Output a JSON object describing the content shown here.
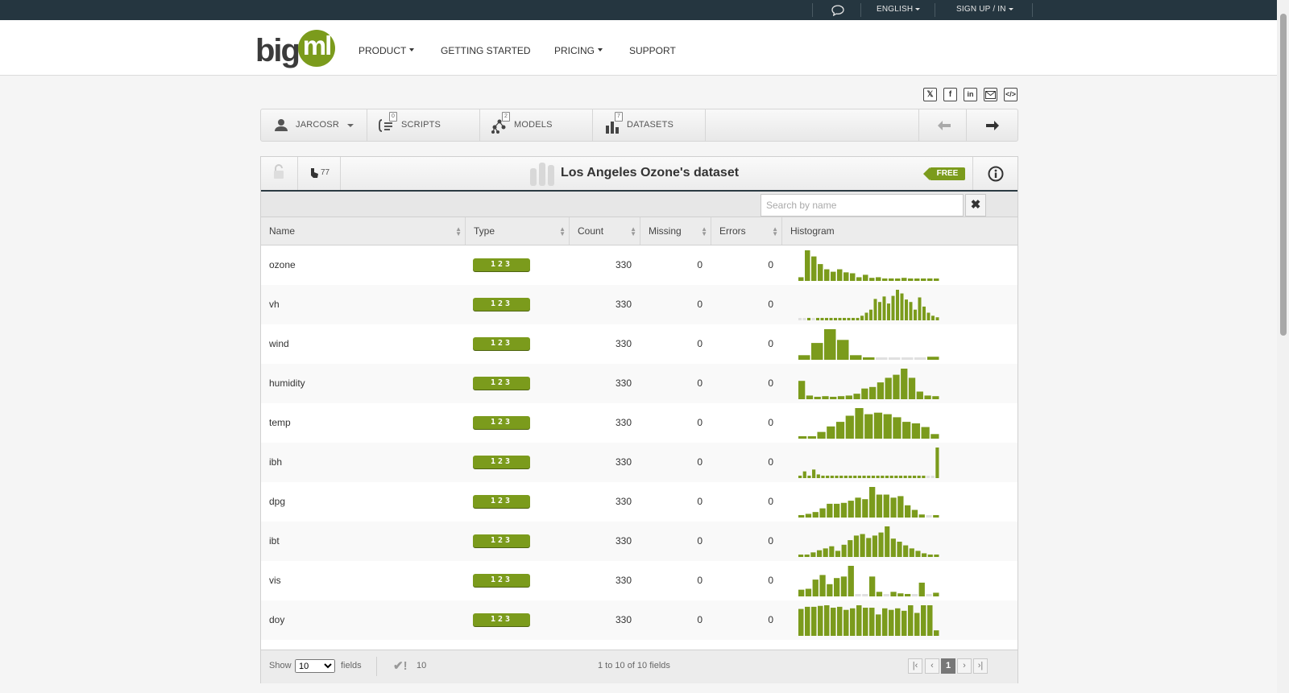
{
  "topbar": {
    "language": "ENGLISH",
    "signup": "SIGN UP / IN"
  },
  "logo": {
    "part1": "big",
    "part2": "ml"
  },
  "nav": [
    {
      "label": "PRODUCT",
      "dropdown": true
    },
    {
      "label": "GETTING STARTED",
      "dropdown": false
    },
    {
      "label": "PRICING",
      "dropdown": true
    },
    {
      "label": "SUPPORT",
      "dropdown": false
    }
  ],
  "share_icons": [
    "x-icon",
    "facebook-icon",
    "linkedin-icon",
    "mail-icon",
    "embed-code-icon"
  ],
  "toolbar": {
    "user": "JARCOSR",
    "scripts": "SCRIPTS",
    "scripts_count": "0",
    "models": "MODELS",
    "models_count": "2",
    "datasets": "DATASETS",
    "datasets_count": "7"
  },
  "dataset": {
    "title": "Los Angeles Ozone's dataset",
    "views": "77",
    "plan_badge": "FREE"
  },
  "search": {
    "placeholder": "Search by name"
  },
  "columns": [
    "Name",
    "Type",
    "Count",
    "Missing",
    "Errors",
    "Histogram"
  ],
  "colors": {
    "accent": "#7b9b1c",
    "topbar": "#253640",
    "empty_bin": "#e0e0e0"
  },
  "fields": [
    {
      "name": "ozone",
      "type": "123",
      "count": "330",
      "missing": "0",
      "errors": "0",
      "histogram": [
        12,
        100,
        80,
        55,
        38,
        30,
        38,
        28,
        25,
        12,
        20,
        10,
        12,
        8,
        8,
        5,
        10,
        5,
        5,
        5,
        8,
        5
      ]
    },
    {
      "name": "vh",
      "type": "123",
      "count": "330",
      "missing": "0",
      "errors": "0",
      "histogram": [
        -1,
        -1,
        8,
        -1,
        8,
        8,
        8,
        8,
        8,
        8,
        8,
        8,
        8,
        8,
        15,
        25,
        35,
        70,
        60,
        78,
        55,
        80,
        100,
        88,
        68,
        60,
        35,
        75,
        45,
        25,
        15,
        10
      ]
    },
    {
      "name": "wind",
      "type": "123",
      "count": "330",
      "missing": "0",
      "errors": "0",
      "histogram": [
        15,
        55,
        100,
        65,
        15,
        8,
        -1,
        -1,
        -1,
        -1,
        10
      ]
    },
    {
      "name": "humidity",
      "type": "123",
      "count": "330",
      "missing": "0",
      "errors": "0",
      "histogram": [
        60,
        12,
        8,
        10,
        8,
        10,
        12,
        18,
        35,
        40,
        55,
        70,
        80,
        100,
        70,
        25,
        12,
        10
      ]
    },
    {
      "name": "temp",
      "type": "123",
      "count": "330",
      "missing": "0",
      "errors": "0",
      "histogram": [
        8,
        8,
        22,
        40,
        55,
        75,
        100,
        80,
        85,
        80,
        70,
        55,
        50,
        38,
        15
      ]
    },
    {
      "name": "ibh",
      "type": "123",
      "count": "330",
      "missing": "0",
      "errors": "0",
      "histogram": [
        8,
        22,
        8,
        28,
        12,
        8,
        8,
        8,
        8,
        8,
        8,
        8,
        8,
        8,
        8,
        8,
        8,
        8,
        8,
        8,
        8,
        8,
        8,
        8,
        8,
        8,
        8,
        8,
        -1,
        -1,
        100
      ]
    },
    {
      "name": "dpg",
      "type": "123",
      "count": "330",
      "missing": "0",
      "errors": "0",
      "histogram": [
        8,
        12,
        18,
        30,
        45,
        45,
        48,
        55,
        65,
        60,
        100,
        75,
        75,
        65,
        70,
        40,
        25,
        10,
        -1,
        8
      ]
    },
    {
      "name": "ibt",
      "type": "123",
      "count": "330",
      "missing": "0",
      "errors": "0",
      "histogram": [
        5,
        8,
        15,
        22,
        28,
        35,
        20,
        40,
        55,
        70,
        75,
        62,
        70,
        80,
        100,
        60,
        50,
        38,
        28,
        20,
        12,
        8,
        8
      ]
    },
    {
      "name": "vis",
      "type": "123",
      "count": "330",
      "missing": "0",
      "errors": "0",
      "histogram": [
        22,
        25,
        55,
        70,
        40,
        60,
        65,
        100,
        -1,
        -1,
        65,
        15,
        -1,
        15,
        10,
        8,
        -1,
        45,
        -1,
        12
      ]
    },
    {
      "name": "doy",
      "type": "123",
      "count": "330",
      "missing": "0",
      "errors": "0",
      "histogram": [
        88,
        95,
        95,
        98,
        100,
        92,
        95,
        85,
        90,
        100,
        92,
        92,
        70,
        90,
        85,
        90,
        82,
        100,
        75,
        100,
        100,
        18
      ]
    }
  ],
  "footer": {
    "show_label": "Show",
    "page_size": "10",
    "fields_label": "fields",
    "valid_count": "10",
    "range_text": "1 to 10 of 10 fields",
    "current_page": "1"
  }
}
